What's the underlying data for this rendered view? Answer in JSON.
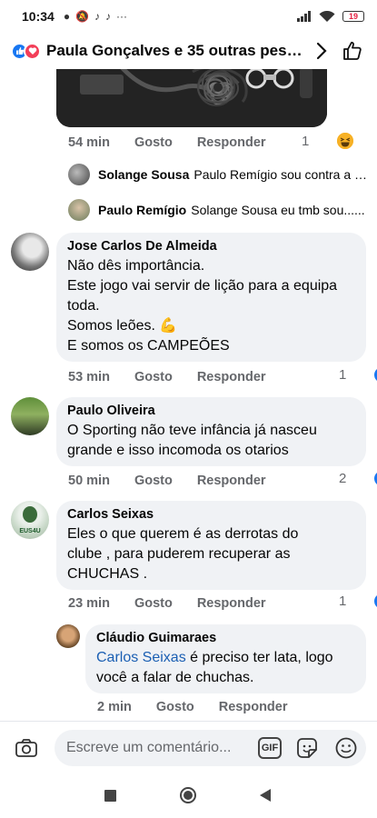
{
  "status": {
    "time": "10:34",
    "battery": "19"
  },
  "header": {
    "title": "Paula Gonçalves e 35 outras pesso...",
    "colors": {
      "like": "#1877f2",
      "love": "#f33e58"
    }
  },
  "top_post_meta": {
    "time": "54 min",
    "like_label": "Gosto",
    "reply_label": "Responder",
    "reaction_count": "1",
    "reaction_icon": "haha-icon"
  },
  "collapsed_replies": [
    {
      "name": "Solange Sousa",
      "text": "Paulo Remígio sou contra a v..."
    },
    {
      "name": "Paulo Remígio",
      "text": "Solange Sousa eu tmb sou......"
    }
  ],
  "comments": [
    {
      "author": "Jose Carlos De Almeida",
      "lines": [
        "Não dês importância.",
        "Este jogo vai servir de lição para a equipa",
        "toda.",
        "Somos leões. 💪",
        "E somos os CAMPEÕES"
      ],
      "time": "53 min",
      "like_label": "Gosto",
      "reply_label": "Responder",
      "reaction_count": "1"
    },
    {
      "author": "Paulo Oliveira",
      "lines": [
        "O Sporting não teve infância já nasceu",
        "grande e isso incomoda os otarios"
      ],
      "time": "50 min",
      "like_label": "Gosto",
      "reply_label": "Responder",
      "reaction_count": "2"
    },
    {
      "author": "Carlos Seixas",
      "lines": [
        "Eles o que querem é as derrotas do",
        "clube , para puderem recuperar as",
        "CHUCHAS ."
      ],
      "time": "23 min",
      "like_label": "Gosto",
      "reply_label": "Responder",
      "reaction_count": "1",
      "avatar_text": "EUS4U"
    }
  ],
  "reply": {
    "author": "Cláudio Guimaraes",
    "mention": "Carlos Seixas",
    "line1_rest": " é preciso ter lata, logo",
    "line2": "você a falar de chuchas.",
    "time": "2 min",
    "like_label": "Gosto",
    "reply_label": "Responder"
  },
  "composer": {
    "placeholder": "Escreve um comentário...",
    "gif_label": "GIF"
  }
}
